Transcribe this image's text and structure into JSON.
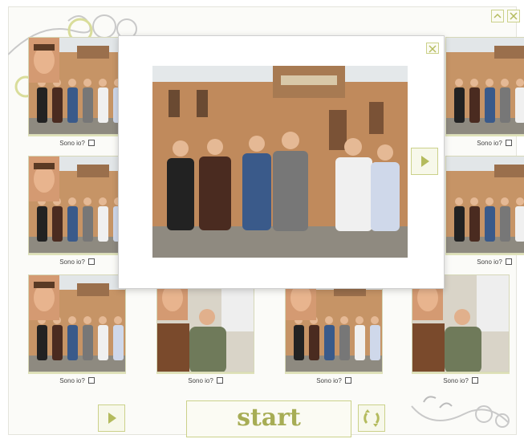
{
  "app": {
    "accent_color": "#b4bb5d",
    "background_color": "#fbfbf8"
  },
  "window_controls": {
    "minimize_icon": "chevron-up-icon",
    "close_icon": "close-icon"
  },
  "cards": [
    {
      "caption": "Sono io?",
      "photo": "group-with-face-inset",
      "checked": false
    },
    {
      "caption": "Sono io?",
      "photo": "group-in-courtyard",
      "checked": false
    },
    {
      "caption": "Sono io?",
      "photo": "group-with-face-inset",
      "checked": false
    },
    {
      "caption": "Sono io?",
      "photo": "group-in-courtyard",
      "checked": false
    },
    {
      "caption": "Sono io?",
      "photo": "group-with-face-inset",
      "checked": false
    },
    {
      "caption": "Sono io?",
      "photo": "man-in-office-with-face-inset",
      "checked": false
    },
    {
      "caption": "Sono io?",
      "photo": "group-with-face-inset",
      "checked": false
    },
    {
      "caption": "Sono io?",
      "photo": "man-in-office-with-face-inset",
      "checked": false
    }
  ],
  "popup": {
    "photo": "group-of-six-men-in-courtyard",
    "close_icon": "close-icon",
    "next_icon": "play-right-icon"
  },
  "controls": {
    "start_label": "start",
    "prev_icon": "play-right-icon",
    "refresh_icon": "refresh-icon"
  }
}
